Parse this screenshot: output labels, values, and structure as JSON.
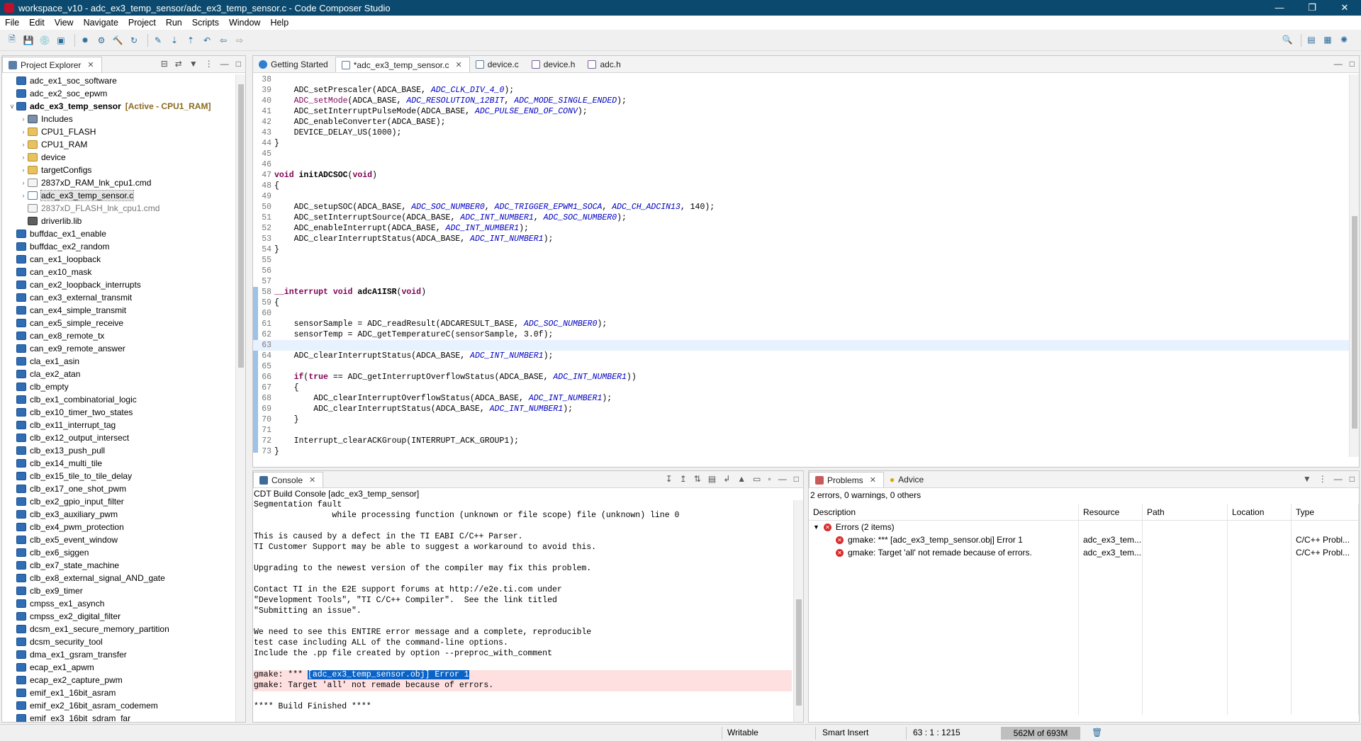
{
  "window": {
    "title": "workspace_v10 - adc_ex3_temp_sensor/adc_ex3_temp_sensor.c - Code Composer Studio"
  },
  "menu": [
    "File",
    "Edit",
    "View",
    "Navigate",
    "Project",
    "Run",
    "Scripts",
    "Window",
    "Help"
  ],
  "explorer": {
    "title": "Project Explorer",
    "items": [
      {
        "label": "adc_ex1_soc_software",
        "type": "proj",
        "indent": 0
      },
      {
        "label": "adc_ex2_soc_epwm",
        "type": "proj",
        "indent": 0
      },
      {
        "label": "adc_ex3_temp_sensor",
        "type": "proj",
        "indent": 0,
        "expanded": true,
        "bold": true,
        "tag": "[Active - CPU1_RAM]"
      },
      {
        "label": "Includes",
        "type": "inc",
        "indent": 1,
        "twisty": true
      },
      {
        "label": "CPU1_FLASH",
        "type": "folder",
        "indent": 1,
        "twisty": true
      },
      {
        "label": "CPU1_RAM",
        "type": "folder",
        "indent": 1,
        "twisty": true
      },
      {
        "label": "device",
        "type": "folder",
        "indent": 1,
        "twisty": true
      },
      {
        "label": "targetConfigs",
        "type": "folder",
        "indent": 1,
        "twisty": true
      },
      {
        "label": "2837xD_RAM_lnk_cpu1.cmd",
        "type": "file",
        "indent": 1,
        "twisty": true
      },
      {
        "label": "adc_ex3_temp_sensor.c",
        "type": "filec",
        "indent": 1,
        "twisty": true,
        "selected": true
      },
      {
        "label": "2837xD_FLASH_lnk_cpu1.cmd",
        "type": "file",
        "indent": 1,
        "grey": true
      },
      {
        "label": "driverlib.lib",
        "type": "lib",
        "indent": 1
      },
      {
        "label": "buffdac_ex1_enable",
        "type": "proj",
        "indent": 0
      },
      {
        "label": "buffdac_ex2_random",
        "type": "proj",
        "indent": 0
      },
      {
        "label": "can_ex1_loopback",
        "type": "proj",
        "indent": 0
      },
      {
        "label": "can_ex10_mask",
        "type": "proj",
        "indent": 0
      },
      {
        "label": "can_ex2_loopback_interrupts",
        "type": "proj",
        "indent": 0
      },
      {
        "label": "can_ex3_external_transmit",
        "type": "proj",
        "indent": 0
      },
      {
        "label": "can_ex4_simple_transmit",
        "type": "proj",
        "indent": 0
      },
      {
        "label": "can_ex5_simple_receive",
        "type": "proj",
        "indent": 0
      },
      {
        "label": "can_ex8_remote_tx",
        "type": "proj",
        "indent": 0
      },
      {
        "label": "can_ex9_remote_answer",
        "type": "proj",
        "indent": 0
      },
      {
        "label": "cla_ex1_asin",
        "type": "proj",
        "indent": 0
      },
      {
        "label": "cla_ex2_atan",
        "type": "proj",
        "indent": 0
      },
      {
        "label": "clb_empty",
        "type": "proj",
        "indent": 0
      },
      {
        "label": "clb_ex1_combinatorial_logic",
        "type": "proj",
        "indent": 0
      },
      {
        "label": "clb_ex10_timer_two_states",
        "type": "proj",
        "indent": 0
      },
      {
        "label": "clb_ex11_interrupt_tag",
        "type": "proj",
        "indent": 0
      },
      {
        "label": "clb_ex12_output_intersect",
        "type": "proj",
        "indent": 0
      },
      {
        "label": "clb_ex13_push_pull",
        "type": "proj",
        "indent": 0
      },
      {
        "label": "clb_ex14_multi_tile",
        "type": "proj",
        "indent": 0
      },
      {
        "label": "clb_ex15_tile_to_tile_delay",
        "type": "proj",
        "indent": 0
      },
      {
        "label": "clb_ex17_one_shot_pwm",
        "type": "proj",
        "indent": 0
      },
      {
        "label": "clb_ex2_gpio_input_filter",
        "type": "proj",
        "indent": 0
      },
      {
        "label": "clb_ex3_auxiliary_pwm",
        "type": "proj",
        "indent": 0
      },
      {
        "label": "clb_ex4_pwm_protection",
        "type": "proj",
        "indent": 0
      },
      {
        "label": "clb_ex5_event_window",
        "type": "proj",
        "indent": 0
      },
      {
        "label": "clb_ex6_siggen",
        "type": "proj",
        "indent": 0
      },
      {
        "label": "clb_ex7_state_machine",
        "type": "proj",
        "indent": 0
      },
      {
        "label": "clb_ex8_external_signal_AND_gate",
        "type": "proj",
        "indent": 0
      },
      {
        "label": "clb_ex9_timer",
        "type": "proj",
        "indent": 0
      },
      {
        "label": "cmpss_ex1_asynch",
        "type": "proj",
        "indent": 0
      },
      {
        "label": "cmpss_ex2_digital_filter",
        "type": "proj",
        "indent": 0
      },
      {
        "label": "dcsm_ex1_secure_memory_partition",
        "type": "proj",
        "indent": 0
      },
      {
        "label": "dcsm_security_tool",
        "type": "proj",
        "indent": 0
      },
      {
        "label": "dma_ex1_gsram_transfer",
        "type": "proj",
        "indent": 0
      },
      {
        "label": "ecap_ex1_apwm",
        "type": "proj",
        "indent": 0
      },
      {
        "label": "ecap_ex2_capture_pwm",
        "type": "proj",
        "indent": 0
      },
      {
        "label": "emif_ex1_16bit_asram",
        "type": "proj",
        "indent": 0
      },
      {
        "label": "emif_ex2_16bit_asram_codemem",
        "type": "proj",
        "indent": 0
      },
      {
        "label": "emif_ex3_16bit_sdram_far",
        "type": "proj",
        "indent": 0
      }
    ]
  },
  "editor": {
    "tabs": [
      {
        "label": "Getting Started",
        "active": false
      },
      {
        "label": "*adc_ex3_temp_sensor.c",
        "active": true
      },
      {
        "label": "device.c",
        "active": false
      },
      {
        "label": "device.h",
        "active": false
      },
      {
        "label": "adc.h",
        "active": false
      }
    ],
    "current_line": 63,
    "lines": [
      {
        "n": "38",
        "html": ""
      },
      {
        "n": "39",
        "html": "    ADC_setPrescaler(ADCA_BASE, <i class=\"it\">ADC_CLK_DIV_4_0</i>);"
      },
      {
        "n": "40",
        "html": "    <span style=\"color:#7f0055\">ADC_setMode</span>(ADCA_BASE, <i class=\"it\">ADC_RESOLUTION_12BIT</i>, <i class=\"it\">ADC_MODE_SINGLE_ENDED</i>);"
      },
      {
        "n": "41",
        "html": "    ADC_setInterruptPulseMode(ADCA_BASE, <i class=\"it\">ADC_PULSE_END_OF_CONV</i>);"
      },
      {
        "n": "42",
        "html": "    ADC_enableConverter(ADCA_BASE);"
      },
      {
        "n": "43",
        "html": "    DEVICE_DELAY_US(1000);"
      },
      {
        "n": "44",
        "html": "}"
      },
      {
        "n": "45",
        "html": ""
      },
      {
        "n": "46",
        "html": ""
      },
      {
        "n": "47",
        "html": "<span class=\"kw\">void</span> <span class=\"fn\">initADCSOC</span>(<span class=\"kw\">void</span>)"
      },
      {
        "n": "48",
        "html": "{"
      },
      {
        "n": "49",
        "html": ""
      },
      {
        "n": "50",
        "html": "    ADC_setupSOC(ADCA_BASE, <i class=\"it\">ADC_SOC_NUMBER0</i>, <i class=\"it\">ADC_TRIGGER_EPWM1_SOCA</i>, <i class=\"it\">ADC_CH_ADCIN13</i>, 140);"
      },
      {
        "n": "51",
        "html": "    ADC_setInterruptSource(ADCA_BASE, <i class=\"it\">ADC_INT_NUMBER1</i>, <i class=\"it\">ADC_SOC_NUMBER0</i>);"
      },
      {
        "n": "52",
        "html": "    ADC_enableInterrupt(ADCA_BASE, <i class=\"it\">ADC_INT_NUMBER1</i>);"
      },
      {
        "n": "53",
        "html": "    ADC_clearInterruptStatus(ADCA_BASE, <i class=\"it\">ADC_INT_NUMBER1</i>);"
      },
      {
        "n": "54",
        "html": "}"
      },
      {
        "n": "55",
        "html": ""
      },
      {
        "n": "56",
        "html": ""
      },
      {
        "n": "57",
        "html": ""
      },
      {
        "n": "58",
        "html": "<span class=\"kw\">__interrupt</span> <span class=\"kw\">void</span> <span class=\"fn\">adcA1ISR</span>(<span class=\"kw\">void</span>)"
      },
      {
        "n": "59",
        "html": "{"
      },
      {
        "n": "60",
        "html": ""
      },
      {
        "n": "61",
        "html": "    sensorSample = ADC_readResult(ADCARESULT_BASE, <i class=\"it\">ADC_SOC_NUMBER0</i>);"
      },
      {
        "n": "62",
        "html": "    sensorTemp = ADC_getTemperatureC(sensorSample, 3.0f);"
      },
      {
        "n": "63",
        "html": ""
      },
      {
        "n": "64",
        "html": "    ADC_clearInterruptStatus(ADCA_BASE, <i class=\"it\">ADC_INT_NUMBER1</i>);"
      },
      {
        "n": "65",
        "html": ""
      },
      {
        "n": "66",
        "html": "    <span class=\"kw\">if</span>(<span class=\"kw\">true</span> == ADC_getInterruptOverflowStatus(ADCA_BASE, <i class=\"it\">ADC_INT_NUMBER1</i>))"
      },
      {
        "n": "67",
        "html": "    {"
      },
      {
        "n": "68",
        "html": "        ADC_clearInterruptOverflowStatus(ADCA_BASE, <i class=\"it\">ADC_INT_NUMBER1</i>);"
      },
      {
        "n": "69",
        "html": "        ADC_clearInterruptStatus(ADCA_BASE, <i class=\"it\">ADC_INT_NUMBER1</i>);"
      },
      {
        "n": "70",
        "html": "    }"
      },
      {
        "n": "71",
        "html": ""
      },
      {
        "n": "72",
        "html": "    Interrupt_clearACKGroup(INTERRUPT_ACK_GROUP1);"
      },
      {
        "n": "73",
        "html": "}"
      }
    ]
  },
  "console": {
    "tab": "Console",
    "subtitle": "CDT Build Console [adc_ex3_temp_sensor]",
    "lines": [
      {
        "t": "Segmentation fault",
        "cls": ""
      },
      {
        "t": "                while processing function (unknown or file scope) file (unknown) line 0",
        "cls": ""
      },
      {
        "t": "",
        "cls": ""
      },
      {
        "t": "This is caused by a defect in the TI EABI C/C++ Parser.",
        "cls": ""
      },
      {
        "t": "TI Customer Support may be able to suggest a workaround to avoid this.",
        "cls": ""
      },
      {
        "t": "",
        "cls": ""
      },
      {
        "t": "Upgrading to the newest version of the compiler may fix this problem.",
        "cls": ""
      },
      {
        "t": "",
        "cls": ""
      },
      {
        "t": "Contact TI in the E2E support forums at http://e2e.ti.com under",
        "cls": ""
      },
      {
        "t": "\"Development Tools\", \"TI C/C++ Compiler\".  See the link titled",
        "cls": ""
      },
      {
        "t": "\"Submitting an issue\".",
        "cls": ""
      },
      {
        "t": "",
        "cls": ""
      },
      {
        "t": "We need to see this ENTIRE error message and a complete, reproducible",
        "cls": ""
      },
      {
        "t": "test case including ALL of the command-line options.",
        "cls": ""
      },
      {
        "t": "Include the .pp file created by option --preproc_with_comment",
        "cls": ""
      },
      {
        "t": "",
        "cls": ""
      },
      {
        "t": "gmake: *** ",
        "cls": "err",
        "hl": "[adc_ex3_temp_sensor.obj] Error 1"
      },
      {
        "t": "gmake: Target 'all' not remade because of errors.",
        "cls": "err"
      },
      {
        "t": "",
        "cls": ""
      },
      {
        "t": "**** Build Finished ****",
        "cls": ""
      }
    ]
  },
  "problems": {
    "tabs": [
      "Problems",
      "Advice"
    ],
    "summary": "2 errors, 0 warnings, 0 others",
    "columns": [
      "Description",
      "Resource",
      "Path",
      "Location",
      "Type"
    ],
    "group": "Errors (2 items)",
    "rows": [
      {
        "desc": "gmake: *** [adc_ex3_temp_sensor.obj] Error 1",
        "res": "adc_ex3_tem...",
        "path": "",
        "loc": "",
        "type": "C/C++ Probl..."
      },
      {
        "desc": "gmake: Target 'all' not remade because of errors.",
        "res": "adc_ex3_tem...",
        "path": "",
        "loc": "",
        "type": "C/C++ Probl..."
      }
    ]
  },
  "status": {
    "writable": "Writable",
    "insert_mode": "Smart Insert",
    "position": "63 : 1 : 1215",
    "heap": "562M of 693M"
  }
}
